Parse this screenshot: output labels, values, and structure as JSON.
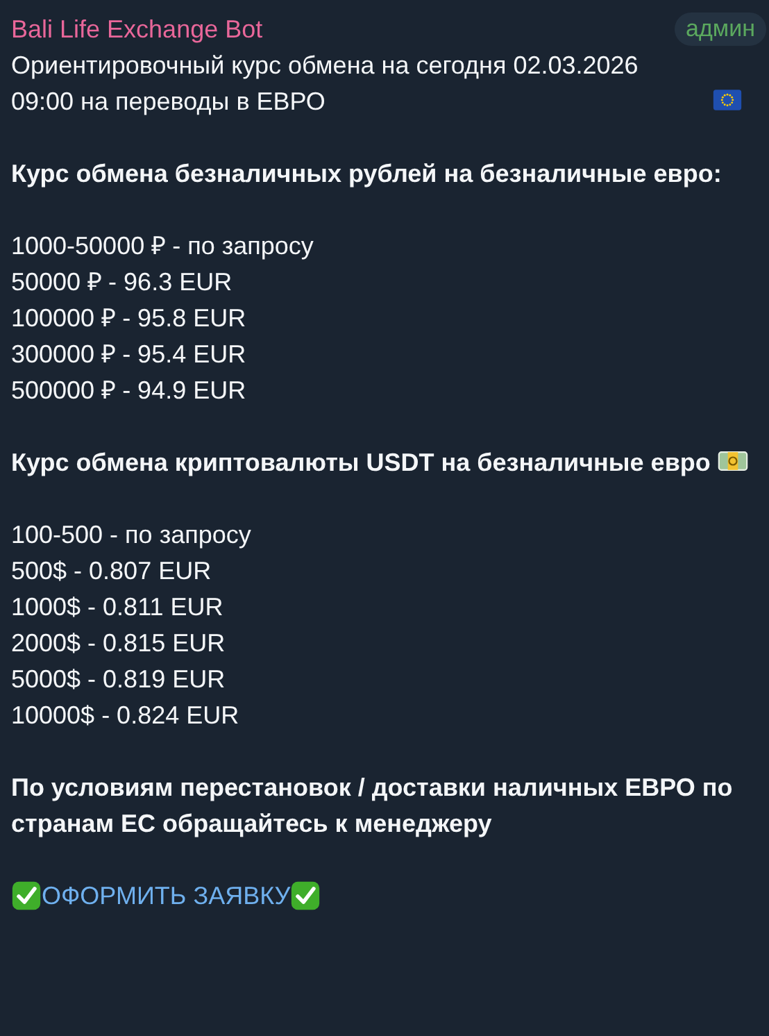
{
  "sender": "Bali Life Exchange Bot",
  "role_badge": "админ",
  "blocks": [
    {
      "kind": "lead",
      "text": "Ориентировочный курс обмена на сегодня 02.03.2026 09:00 на переводы в ЕВРО"
    },
    {
      "kind": "heading",
      "text": "Курс обмена безналичных рублей на безналичные евро:"
    },
    {
      "kind": "rates",
      "lines": [
        "1000-50000 ₽ - по запросу",
        "50000 ₽ - 96.3 EUR",
        "100000 ₽ - 95.8 EUR",
        "300000 ₽ - 95.4 EUR",
        "500000 ₽ - 94.9 EUR"
      ]
    },
    {
      "kind": "heading-money",
      "text": "Курс обмена криптовалюты USDT на безналичные евро"
    },
    {
      "kind": "rates",
      "lines": [
        "100-500 - по запросу",
        "500$ - 0.807 EUR",
        "1000$ - 0.811 EUR",
        "2000$ - 0.815 EUR",
        "5000$ - 0.819 EUR",
        "10000$ - 0.824 EUR"
      ]
    },
    {
      "kind": "heading",
      "text": "По условиям перестановок / доставки наличных ЕВРО по странам ЕС обращайтесь к менеджеру"
    },
    {
      "kind": "link",
      "text": "ОФОРМИТЬ ЗАЯВКУ"
    }
  ]
}
